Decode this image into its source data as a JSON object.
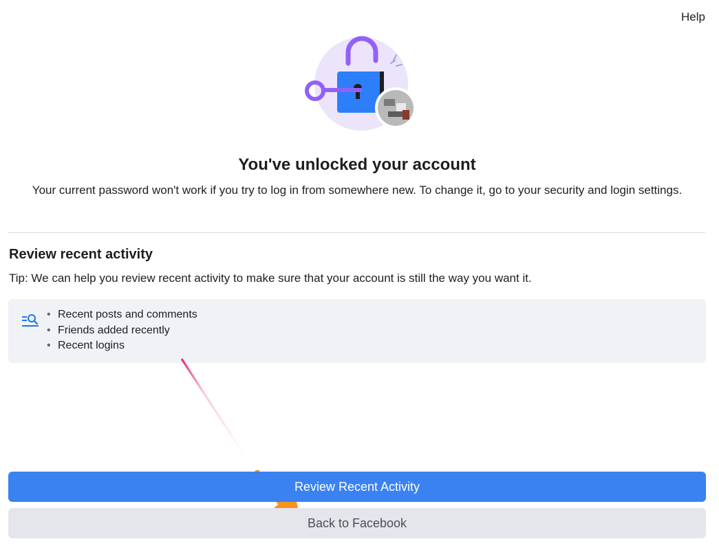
{
  "header": {
    "help_label": "Help"
  },
  "main": {
    "title": "You've unlocked your account",
    "subtitle": "Your current password won't work if you try to log in from somewhere new. To change it, go to your security and login settings."
  },
  "review": {
    "title": "Review recent activity",
    "tip": "Tip: We can help you review recent activity to make sure that your account is still the way you want it.",
    "icon": "search-list-icon",
    "items": [
      "Recent posts and comments",
      "Friends added recently",
      "Recent logins"
    ]
  },
  "actions": {
    "review_label": "Review Recent Activity",
    "back_label": "Back to Facebook"
  },
  "colors": {
    "primary": "#3b82f1",
    "secondary_bg": "#e4e6eb",
    "box_bg": "#f0f2f5",
    "icon_blue": "#1877f2",
    "lock_purple": "#9360f7",
    "annotation_orange": "#f7931e",
    "annotation_pink": "#e6287a"
  }
}
